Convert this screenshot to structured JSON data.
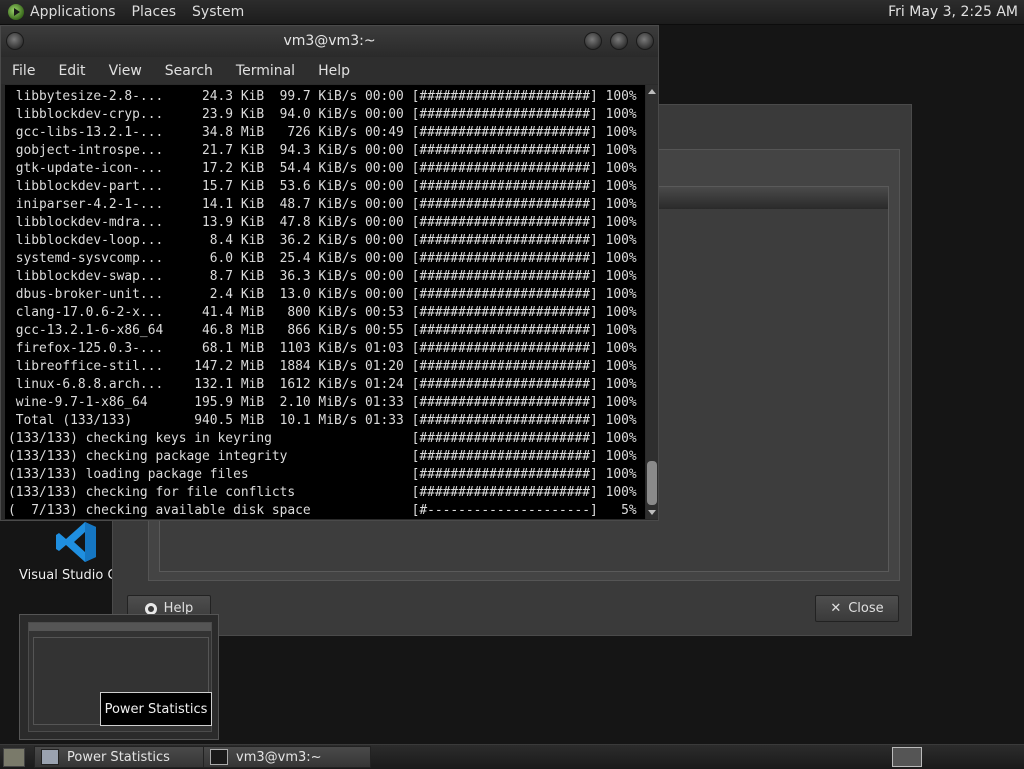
{
  "top_panel": {
    "menus": [
      "Applications",
      "Places",
      "System"
    ],
    "clock": "Fri May  3,  2:25 AM"
  },
  "desktop": {
    "vscode_label": "Visual Studio Co"
  },
  "dialog": {
    "help_label": "Help",
    "close_label": "Close"
  },
  "terminal": {
    "title": "vm3@vm3:~",
    "menu": [
      "File",
      "Edit",
      "View",
      "Search",
      "Terminal",
      "Help"
    ],
    "lines": [
      " libbytesize-2.8-...     24.3 KiB  99.7 KiB/s 00:00 [######################] 100%",
      " libblockdev-cryp...     23.9 KiB  94.0 KiB/s 00:00 [######################] 100%",
      " gcc-libs-13.2.1-...     34.8 MiB   726 KiB/s 00:49 [######################] 100%",
      " gobject-introspe...     21.7 KiB  94.3 KiB/s 00:00 [######################] 100%",
      " gtk-update-icon-...     17.2 KiB  54.4 KiB/s 00:00 [######################] 100%",
      " libblockdev-part...     15.7 KiB  53.6 KiB/s 00:00 [######################] 100%",
      " iniparser-4.2-1-...     14.1 KiB  48.7 KiB/s 00:00 [######################] 100%",
      " libblockdev-mdra...     13.9 KiB  47.8 KiB/s 00:00 [######################] 100%",
      " libblockdev-loop...      8.4 KiB  36.2 KiB/s 00:00 [######################] 100%",
      " systemd-sysvcomp...      6.0 KiB  25.4 KiB/s 00:00 [######################] 100%",
      " libblockdev-swap...      8.7 KiB  36.3 KiB/s 00:00 [######################] 100%",
      " dbus-broker-unit...      2.4 KiB  13.0 KiB/s 00:00 [######################] 100%",
      " clang-17.0.6-2-x...     41.4 MiB   800 KiB/s 00:53 [######################] 100%",
      " gcc-13.2.1-6-x86_64     46.8 MiB   866 KiB/s 00:55 [######################] 100%",
      " firefox-125.0.3-...     68.1 MiB  1103 KiB/s 01:03 [######################] 100%",
      " libreoffice-stil...    147.2 MiB  1884 KiB/s 01:20 [######################] 100%",
      " linux-6.8.8.arch...    132.1 MiB  1612 KiB/s 01:24 [######################] 100%",
      " wine-9.7-1-x86_64      195.9 MiB  2.10 MiB/s 01:33 [######################] 100%",
      " Total (133/133)        940.5 MiB  10.1 MiB/s 01:33 [######################] 100%",
      "(133/133) checking keys in keyring                  [######################] 100%",
      "(133/133) checking package integrity                [######################] 100%",
      "(133/133) loading package files                     [######################] 100%",
      "(133/133) checking for file conflicts               [######################] 100%",
      "(  7/133) checking available disk space             [#---------------------]   5%"
    ]
  },
  "preview": {
    "tooltip": "Power Statistics"
  },
  "taskbar": {
    "items": [
      "Power Statistics",
      "vm3@vm3:~"
    ]
  }
}
